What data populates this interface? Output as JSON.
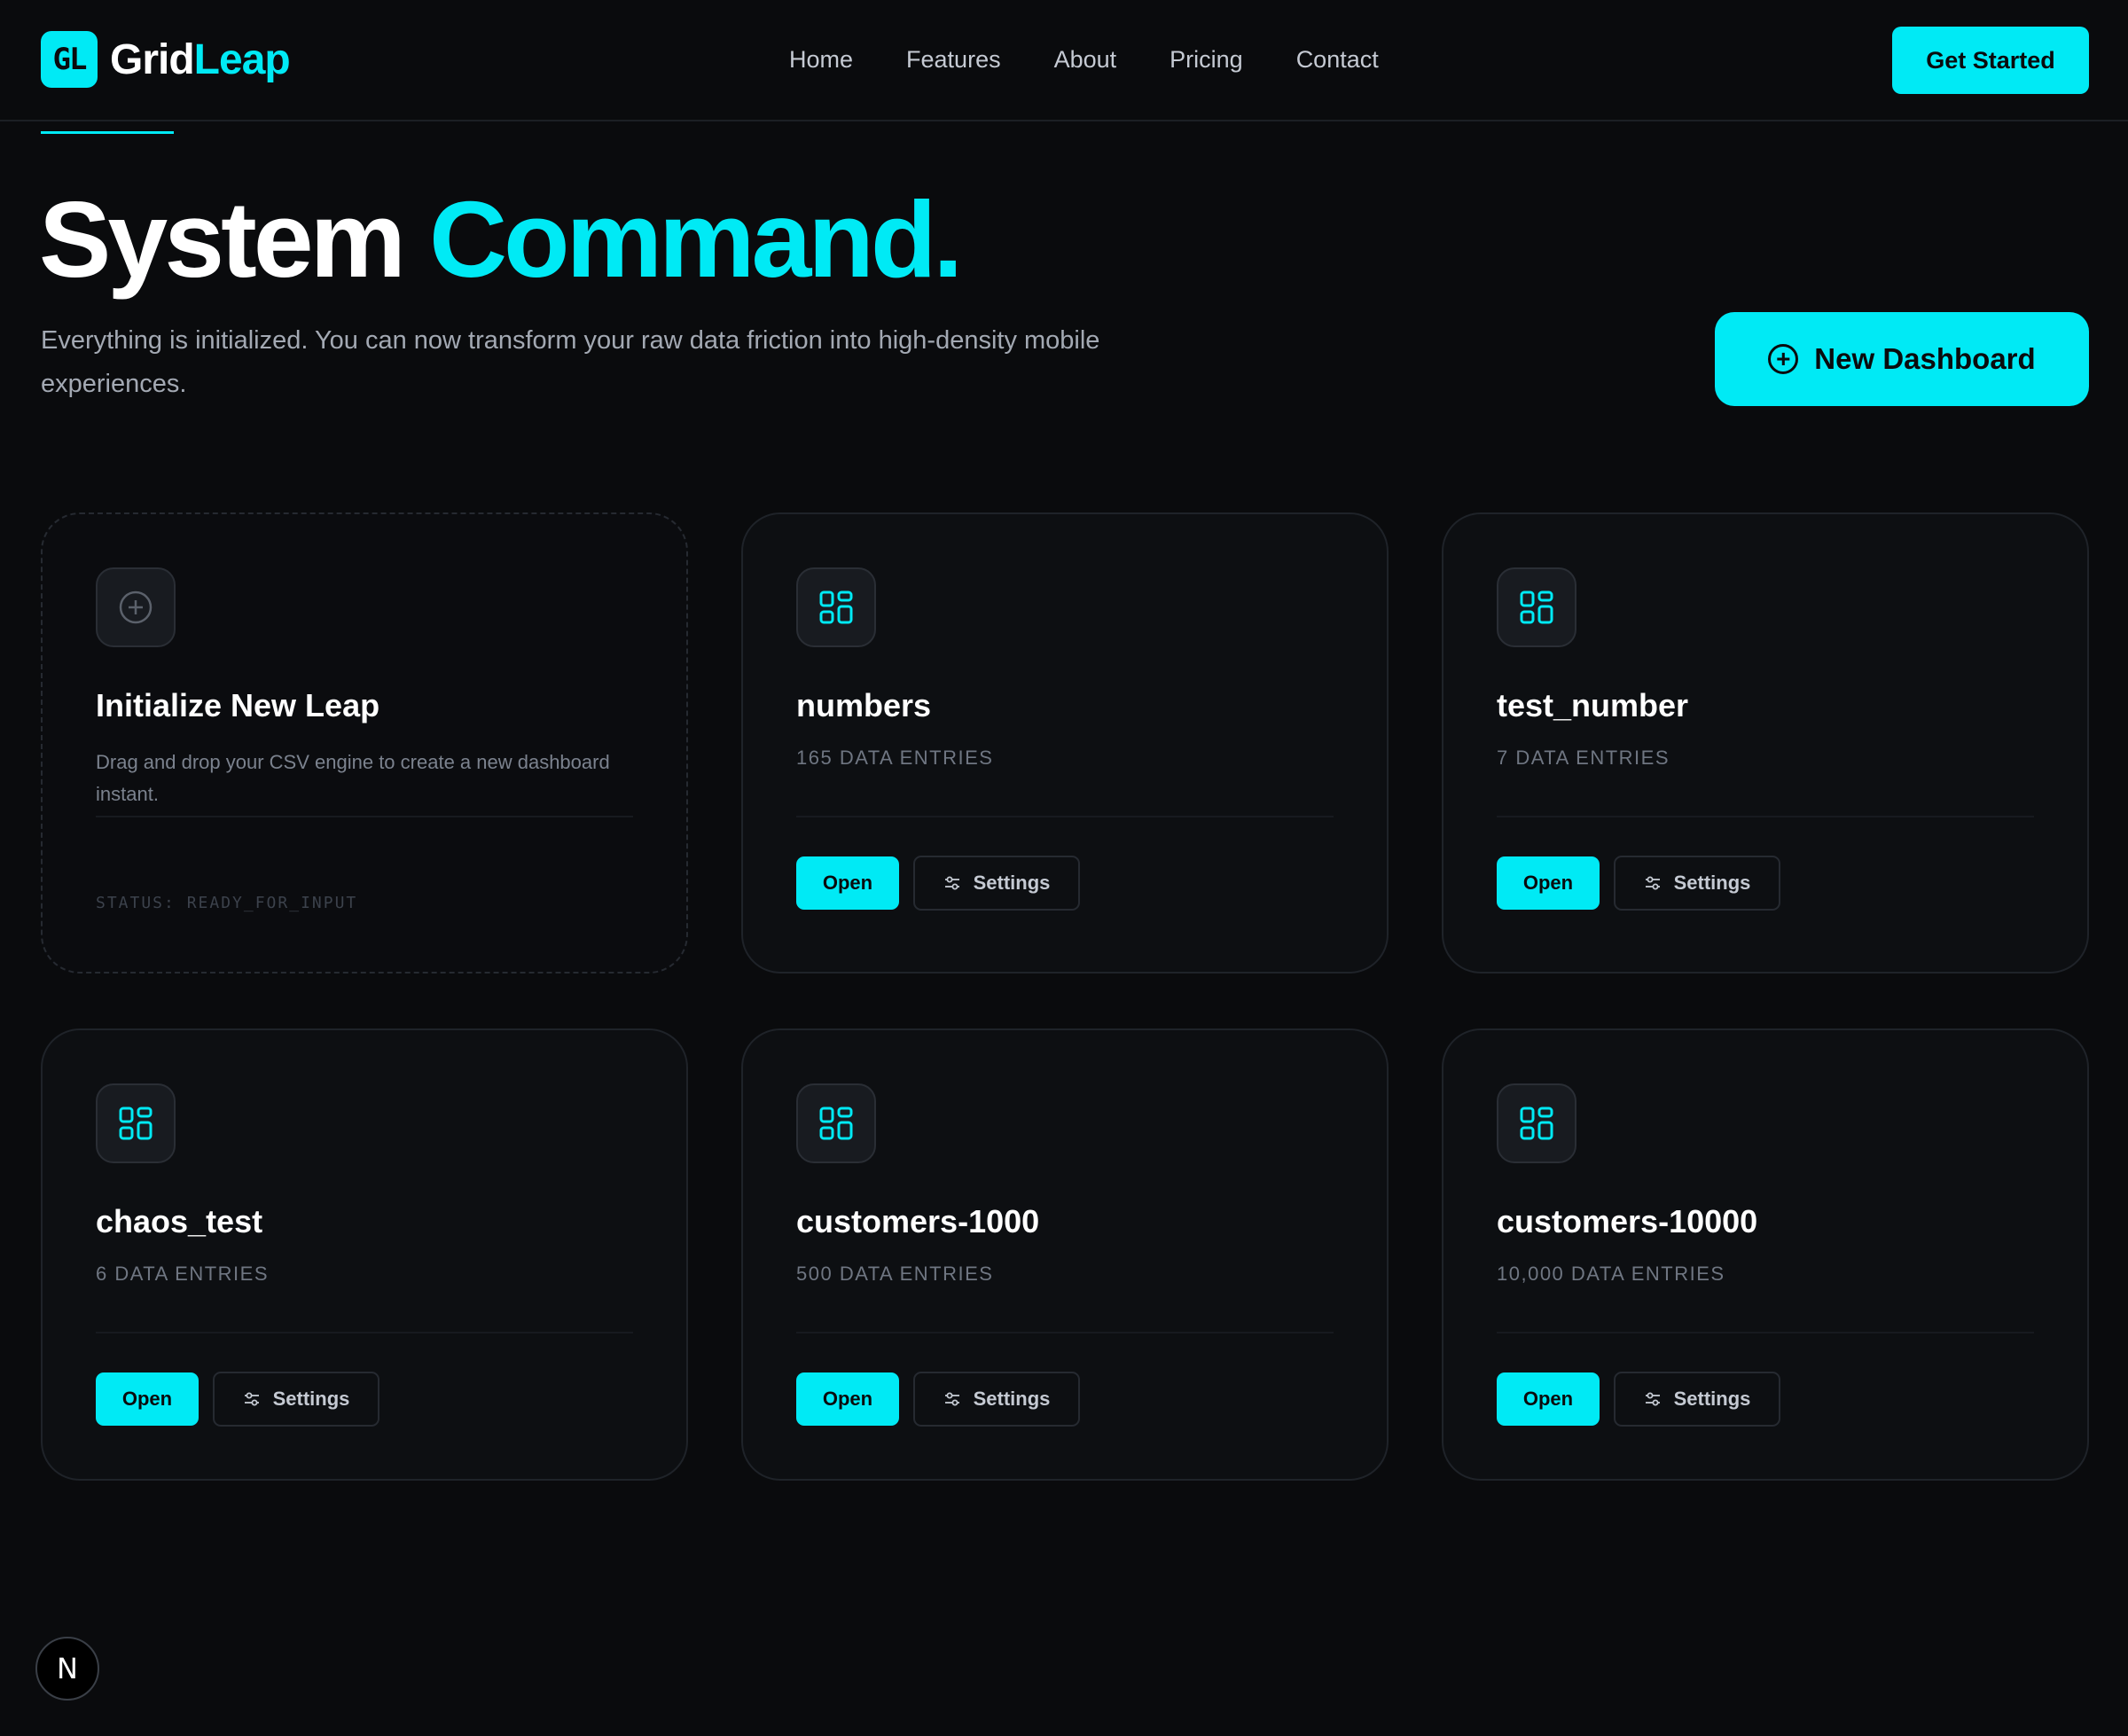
{
  "brand": {
    "mark": "GL",
    "name_part1": "Grid",
    "name_part2": "Leap",
    "accent_color": "#00eaf5"
  },
  "nav": {
    "items": [
      "Home",
      "Features",
      "About",
      "Pricing",
      "Contact"
    ],
    "cta": "Get Started"
  },
  "hero": {
    "title_part1": "System",
    "title_part2": "Command.",
    "subtitle": "Everything is initialized. You can now transform your raw data friction into high-density mobile experiences.",
    "new_dashboard_label": "New Dashboard"
  },
  "init_card": {
    "icon": "plus-circle-icon",
    "title": "Initialize New Leap",
    "description": "Drag and drop your CSV engine to create a new dashboard instant.",
    "status": "STATUS: READY_FOR_INPUT"
  },
  "dashboards": [
    {
      "name": "numbers",
      "entries": "165 DATA ENTRIES",
      "open_label": "Open",
      "settings_label": "Settings",
      "icon": "grid-dashboard-icon"
    },
    {
      "name": "test_number",
      "entries": "7 DATA ENTRIES",
      "open_label": "Open",
      "settings_label": "Settings",
      "icon": "grid-dashboard-icon"
    },
    {
      "name": "chaos_test",
      "entries": "6 DATA ENTRIES",
      "open_label": "Open",
      "settings_label": "Settings",
      "icon": "grid-dashboard-icon"
    },
    {
      "name": "customers-1000",
      "entries": "500 DATA ENTRIES",
      "open_label": "Open",
      "settings_label": "Settings",
      "icon": "grid-dashboard-icon"
    },
    {
      "name": "customers-10000",
      "entries": "10,000 DATA ENTRIES",
      "open_label": "Open",
      "settings_label": "Settings",
      "icon": "grid-dashboard-icon"
    }
  ],
  "dev_badge": {
    "letter": "N"
  }
}
